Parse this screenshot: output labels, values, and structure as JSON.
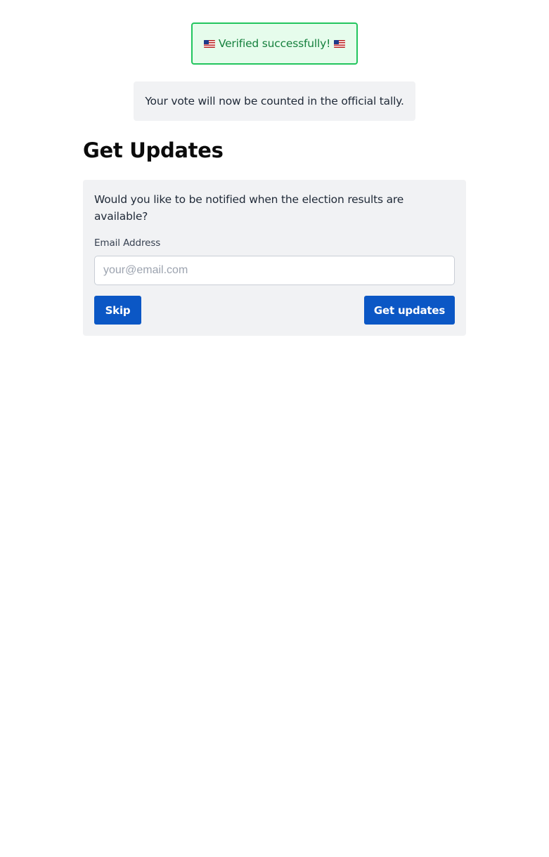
{
  "success_banner": {
    "text": "Verified successfully!",
    "icon_left": "us-flag-icon",
    "icon_right": "us-flag-icon",
    "border_color": "#22c55e",
    "background_color": "#e6fcec",
    "text_color": "#15803d"
  },
  "notice": {
    "text": "Your vote will now be counted in the official tally."
  },
  "updates": {
    "heading": "Get Updates",
    "prompt": "Would you like to be notified when the election results are available?",
    "email_label": "Email Address",
    "email_value": "",
    "email_placeholder": "your@email.com",
    "skip_label": "Skip",
    "submit_label": "Get updates",
    "button_color": "#0b57c5"
  }
}
